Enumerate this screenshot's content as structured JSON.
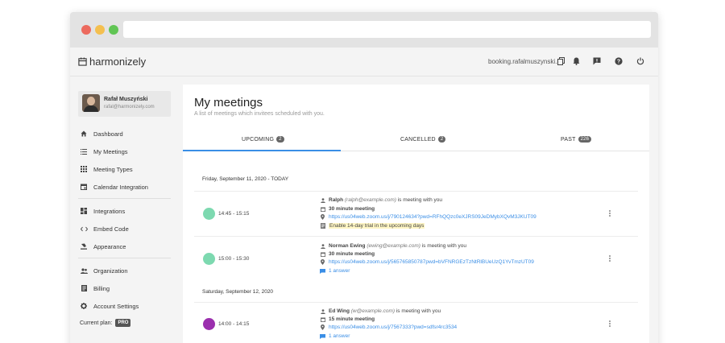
{
  "topbar": {
    "app_name": "harmonizely",
    "booking_url": "booking.rafalmuszynski.pl"
  },
  "sidebar": {
    "profile": {
      "name": "Rafał Muszyński",
      "email": "rafal@harmonizely.com"
    },
    "items": [
      {
        "label": "Dashboard",
        "icon": "home-icon"
      },
      {
        "label": "My Meetings",
        "icon": "list-icon"
      },
      {
        "label": "Meeting Types",
        "icon": "grid-icon"
      },
      {
        "label": "Calendar Integration",
        "icon": "calendar-icon"
      },
      {
        "label": "Integrations",
        "icon": "dashboard-icon"
      },
      {
        "label": "Embed Code",
        "icon": "code-icon"
      },
      {
        "label": "Appearance",
        "icon": "brush-icon"
      },
      {
        "label": "Organization",
        "icon": "people-icon"
      },
      {
        "label": "Billing",
        "icon": "billing-icon"
      },
      {
        "label": "Account Settings",
        "icon": "gear-icon"
      }
    ],
    "plan_label": "Current plan:",
    "plan_badge": "PRO"
  },
  "main": {
    "title": "My meetings",
    "subtitle": "A list of meetings which invitees scheduled with you.",
    "tabs": [
      {
        "label": "UPCOMING",
        "count": "2"
      },
      {
        "label": "CANCELLED",
        "count": "2"
      },
      {
        "label": "PAST",
        "count": "226"
      }
    ],
    "days": [
      {
        "label": "Friday, September 11, 2020 - TODAY"
      },
      {
        "label": "Saturday, September 12, 2020"
      }
    ],
    "meetings": [
      {
        "time": "14:45 - 15:15",
        "color": "#7dd9b0",
        "invitee": "Ralph",
        "invitee_email": "(ralph@example.com)",
        "suffix": "is meeting with you",
        "type": "30 minute meeting",
        "link": "https://us04web.zoom.us/j/790124634?pwd=RFhQQzc0eXJRS09JeDMybXQvM3JKUT09",
        "note": "Enable 14-day trial in the upcoming days"
      },
      {
        "time": "15:00 - 15:30",
        "color": "#7dd9b0",
        "invitee": "Norman Ewing",
        "invitee_email": "(ewing@example.com)",
        "suffix": "is meeting with you",
        "type": "30 minute meeting",
        "link": "https://us04web.zoom.us/j/565765850787pwd=bVFNRGEzTzNtRlBUeUzQ1YvTmzUT09",
        "answers": "1 answer"
      },
      {
        "time": "14:00 - 14:15",
        "color": "#9b2fae",
        "invitee": "Ed Wing",
        "invitee_email": "(w@example.com)",
        "suffix": "is meeting with you",
        "type": "15 minute meeting",
        "link": "https://us04web.zoom.us/j/7567333?pwd=sdfsr4rc3534",
        "answers": "1 answer"
      }
    ]
  }
}
